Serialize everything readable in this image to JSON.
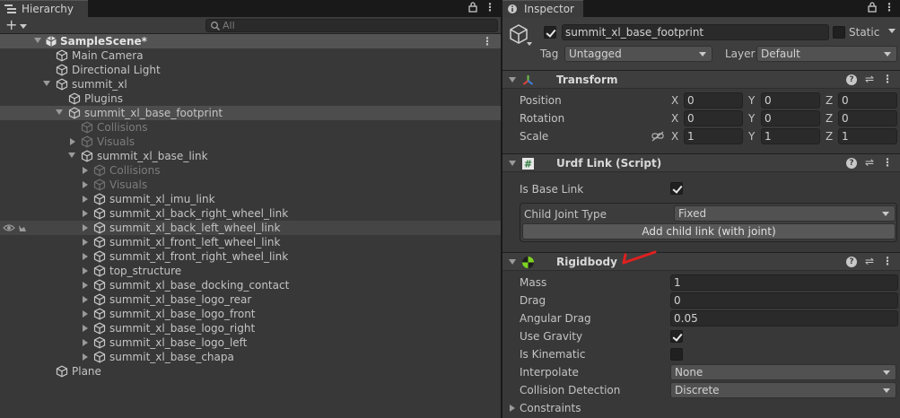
{
  "hierarchy": {
    "tab_label": "Hierarchy",
    "create_label": "+",
    "search_placeholder": "All",
    "scene_name": "SampleScene*",
    "items": [
      {
        "label": "Main Camera"
      },
      {
        "label": "Directional Light"
      },
      {
        "label": "summit_xl"
      },
      {
        "label": "Plugins"
      },
      {
        "label": "summit_xl_base_footprint"
      },
      {
        "label": "Collisions"
      },
      {
        "label": "Visuals"
      },
      {
        "label": "summit_xl_base_link"
      },
      {
        "label": "Collisions"
      },
      {
        "label": "Visuals"
      },
      {
        "label": "summit_xl_imu_link"
      },
      {
        "label": "summit_xl_back_right_wheel_link"
      },
      {
        "label": "summit_xl_back_left_wheel_link"
      },
      {
        "label": "summit_xl_front_left_wheel_link"
      },
      {
        "label": "summit_xl_front_right_wheel_link"
      },
      {
        "label": "top_structure"
      },
      {
        "label": "summit_xl_base_docking_contact"
      },
      {
        "label": "summit_xl_base_logo_rear"
      },
      {
        "label": "summit_xl_base_logo_front"
      },
      {
        "label": "summit_xl_base_logo_right"
      },
      {
        "label": "summit_xl_base_logo_left"
      },
      {
        "label": "summit_xl_base_chapa"
      },
      {
        "label": "Plane"
      }
    ]
  },
  "inspector": {
    "tab_label": "Inspector",
    "object_name": "summit_xl_base_footprint",
    "static_label": "Static",
    "tag_label": "Tag",
    "tag_value": "Untagged",
    "layer_label": "Layer",
    "layer_value": "Default",
    "transform": {
      "title": "Transform",
      "position_label": "Position",
      "rotation_label": "Rotation",
      "scale_label": "Scale",
      "x": "X",
      "y": "Y",
      "z": "Z",
      "position": [
        "0",
        "0",
        "0"
      ],
      "rotation": [
        "0",
        "0",
        "0"
      ],
      "scale": [
        "1",
        "1",
        "1"
      ]
    },
    "urdf": {
      "title": "Urdf Link (Script)",
      "is_base_link_label": "Is Base Link",
      "child_joint_type_label": "Child Joint Type",
      "child_joint_type_value": "Fixed",
      "add_child_label": "Add child link (with joint)"
    },
    "rigidbody": {
      "title": "Rigidbody",
      "mass_label": "Mass",
      "mass_value": "1",
      "drag_label": "Drag",
      "drag_value": "0",
      "angular_drag_label": "Angular Drag",
      "angular_drag_value": "0.05",
      "use_gravity_label": "Use Gravity",
      "is_kinematic_label": "Is Kinematic",
      "interpolate_label": "Interpolate",
      "interpolate_value": "None",
      "collision_detection_label": "Collision Detection",
      "collision_detection_value": "Discrete",
      "constraints_label": "Constraints"
    }
  },
  "colors": {
    "annotation_arrow": "#e02020",
    "panel_bg": "#383838"
  }
}
